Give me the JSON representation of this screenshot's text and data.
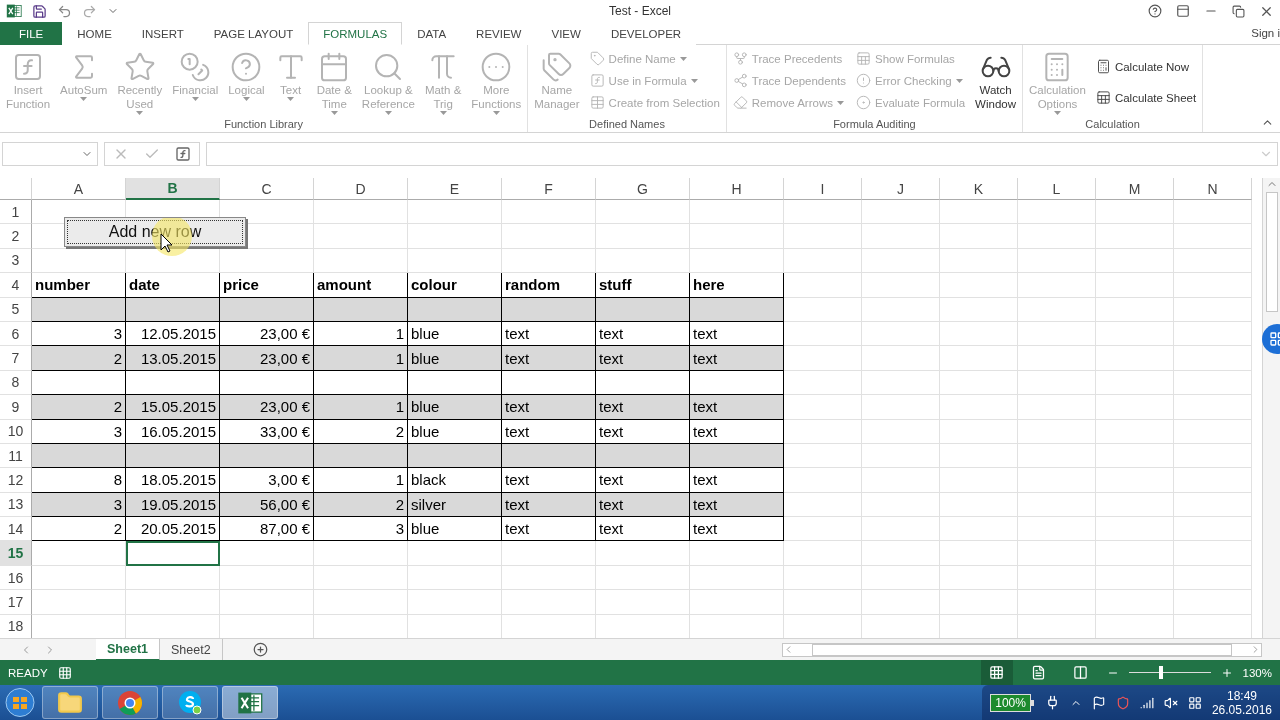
{
  "window": {
    "title": "Test - Excel"
  },
  "ribbon_tabs": [
    {
      "label": "FILE",
      "kind": "file",
      "selected": false
    },
    {
      "label": "HOME",
      "kind": "tab",
      "selected": false
    },
    {
      "label": "INSERT",
      "kind": "tab",
      "selected": false
    },
    {
      "label": "PAGE LAYOUT",
      "kind": "tab",
      "selected": false
    },
    {
      "label": "FORMULAS",
      "kind": "tab",
      "selected": true
    },
    {
      "label": "DATA",
      "kind": "tab",
      "selected": false
    },
    {
      "label": "REVIEW",
      "kind": "tab",
      "selected": false
    },
    {
      "label": "VIEW",
      "kind": "tab",
      "selected": false
    },
    {
      "label": "DEVELOPER",
      "kind": "tab",
      "selected": false
    }
  ],
  "account": "Sign i",
  "ribbon_groups": [
    {
      "label": "Function Library",
      "items": [
        {
          "kind": "large",
          "lines": [
            "Insert",
            "Function"
          ],
          "disabled": true,
          "menu": false
        },
        {
          "kind": "large",
          "lines": [
            "AutoSum"
          ],
          "disabled": true,
          "menu": true
        },
        {
          "kind": "large",
          "lines": [
            "Recently",
            "Used"
          ],
          "disabled": true,
          "menu": true
        },
        {
          "kind": "large",
          "lines": [
            "Financial"
          ],
          "disabled": true,
          "menu": true
        },
        {
          "kind": "large",
          "lines": [
            "Logical"
          ],
          "disabled": true,
          "menu": true
        },
        {
          "kind": "large",
          "lines": [
            "Text"
          ],
          "disabled": true,
          "menu": true
        },
        {
          "kind": "large",
          "lines": [
            "Date &",
            "Time"
          ],
          "disabled": true,
          "menu": true
        },
        {
          "kind": "large",
          "lines": [
            "Lookup &",
            "Reference"
          ],
          "disabled": true,
          "menu": true
        },
        {
          "kind": "large",
          "lines": [
            "Math &",
            "Trig"
          ],
          "disabled": true,
          "menu": true
        },
        {
          "kind": "large",
          "lines": [
            "More",
            "Functions"
          ],
          "disabled": true,
          "menu": true
        }
      ]
    },
    {
      "label": "Defined Names",
      "items": [
        {
          "kind": "large",
          "lines": [
            "Name",
            "Manager"
          ],
          "disabled": true,
          "menu": false
        },
        {
          "kind": "small",
          "lines": [
            "Define Name"
          ],
          "disabled": true,
          "menu": true
        },
        {
          "kind": "small",
          "lines": [
            "Use in Formula"
          ],
          "disabled": true,
          "menu": true
        },
        {
          "kind": "small",
          "lines": [
            "Create from Selection"
          ],
          "disabled": true,
          "menu": false
        }
      ]
    },
    {
      "label": "Formula Auditing",
      "items": [
        {
          "kind": "small",
          "lines": [
            "Trace Precedents"
          ],
          "disabled": true,
          "menu": false
        },
        {
          "kind": "small",
          "lines": [
            "Trace Dependents"
          ],
          "disabled": true,
          "menu": false
        },
        {
          "kind": "small",
          "lines": [
            "Remove Arrows"
          ],
          "disabled": true,
          "menu": true
        },
        {
          "kind": "small",
          "lines": [
            "Show Formulas"
          ],
          "disabled": true,
          "menu": false
        },
        {
          "kind": "small",
          "lines": [
            "Error Checking"
          ],
          "disabled": true,
          "menu": true
        },
        {
          "kind": "small",
          "lines": [
            "Evaluate Formula"
          ],
          "disabled": true,
          "menu": false
        },
        {
          "kind": "large",
          "lines": [
            "Watch",
            "Window"
          ],
          "disabled": false,
          "menu": false
        }
      ]
    },
    {
      "label": "Calculation",
      "items": [
        {
          "kind": "large",
          "lines": [
            "Calculation",
            "Options"
          ],
          "disabled": true,
          "menu": true
        },
        {
          "kind": "small",
          "lines": [
            "Calculate Now"
          ],
          "disabled": false,
          "menu": false
        },
        {
          "kind": "small",
          "lines": [
            "Calculate Sheet"
          ],
          "disabled": false,
          "menu": false
        }
      ]
    }
  ],
  "columns": [
    {
      "label": "A",
      "selected": false
    },
    {
      "label": "B",
      "selected": true
    },
    {
      "label": "C",
      "selected": false
    },
    {
      "label": "D",
      "selected": false
    },
    {
      "label": "E",
      "selected": false
    },
    {
      "label": "F",
      "selected": false
    },
    {
      "label": "G",
      "selected": false
    },
    {
      "label": "H",
      "selected": false
    },
    {
      "label": "I",
      "selected": false
    },
    {
      "label": "J",
      "selected": false
    },
    {
      "label": "K",
      "selected": false
    },
    {
      "label": "L",
      "selected": false
    },
    {
      "label": "M",
      "selected": false
    },
    {
      "label": "N",
      "selected": false
    }
  ],
  "rows": [
    {
      "header": "1",
      "kind": "plain",
      "selected": false
    },
    {
      "header": "2",
      "kind": "plain",
      "selected": false
    },
    {
      "header": "3",
      "kind": "plain",
      "selected": false
    },
    {
      "header": "4",
      "kind": "header",
      "selected": false,
      "cells": [
        "number",
        "date",
        "price",
        "amount",
        "colour",
        "random",
        "stuff",
        "here"
      ]
    },
    {
      "header": "5",
      "kind": "data",
      "selected": false,
      "shaded": true
    },
    {
      "header": "6",
      "kind": "data",
      "selected": false,
      "shaded": false,
      "cells": [
        "3",
        "12.05.2015",
        "23,00 €",
        "1",
        "blue",
        "text",
        "text",
        "text"
      ]
    },
    {
      "header": "7",
      "kind": "data",
      "selected": false,
      "shaded": true,
      "cells": [
        "2",
        "13.05.2015",
        "23,00 €",
        "1",
        "blue",
        "text",
        "text",
        "text"
      ]
    },
    {
      "header": "8",
      "kind": "data",
      "selected": false,
      "shaded": false
    },
    {
      "header": "9",
      "kind": "data",
      "selected": false,
      "shaded": true,
      "cells": [
        "2",
        "15.05.2015",
        "23,00 €",
        "1",
        "blue",
        "text",
        "text",
        "text"
      ]
    },
    {
      "header": "10",
      "kind": "data",
      "selected": false,
      "shaded": false,
      "cells": [
        "3",
        "16.05.2015",
        "33,00 €",
        "2",
        "blue",
        "text",
        "text",
        "text"
      ]
    },
    {
      "header": "11",
      "kind": "data",
      "selected": false,
      "shaded": true
    },
    {
      "header": "12",
      "kind": "data",
      "selected": false,
      "shaded": false,
      "cells": [
        "8",
        "18.05.2015",
        "3,00 €",
        "1",
        "black",
        "text",
        "text",
        "text"
      ]
    },
    {
      "header": "13",
      "kind": "data",
      "selected": false,
      "shaded": true,
      "cells": [
        "3",
        "19.05.2015",
        "56,00 €",
        "2",
        "silver",
        "text",
        "text",
        "text"
      ]
    },
    {
      "header": "14",
      "kind": "data",
      "selected": false,
      "shaded": false,
      "cells": [
        "2",
        "20.05.2015",
        "87,00 €",
        "3",
        "blue",
        "text",
        "text",
        "text"
      ]
    },
    {
      "header": "15",
      "kind": "plain",
      "selected": true
    },
    {
      "header": "16",
      "kind": "plain",
      "selected": false
    },
    {
      "header": "17",
      "kind": "plain",
      "selected": false
    },
    {
      "header": "18",
      "kind": "plain",
      "selected": false
    }
  ],
  "form_button": {
    "label": "Add new row"
  },
  "sheet_tabs": [
    {
      "label": "Sheet1",
      "selected": true
    },
    {
      "label": "Sheet2",
      "selected": false
    }
  ],
  "status_bar": {
    "mode": "READY",
    "zoom": {
      "level": 0.4,
      "reading": "130%"
    }
  },
  "taskbar": {
    "apps": [
      {
        "kind": "explorer",
        "selected": false
      },
      {
        "kind": "chrome",
        "selected": false
      },
      {
        "kind": "skype",
        "selected": false
      },
      {
        "kind": "excel",
        "selected": true
      }
    ],
    "battery": "100%",
    "time": "18:49",
    "date": "26.05.2016"
  }
}
